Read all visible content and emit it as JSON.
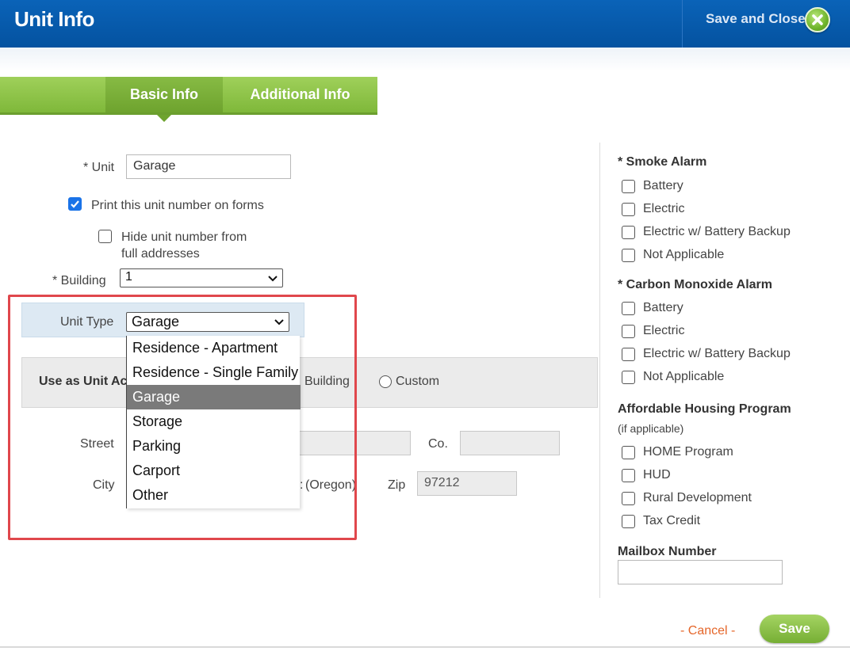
{
  "header": {
    "title": "Unit Info",
    "save_close_label": "Save and Close",
    "close_icon": "close-circle-icon"
  },
  "tabs": [
    {
      "label": "Basic Info",
      "active": true
    },
    {
      "label": "Additional Info",
      "active": false
    }
  ],
  "form": {
    "unit_label": "* Unit",
    "unit_value": "Garage",
    "print_unit_label": "Print this unit number on forms",
    "print_unit_checked": true,
    "hide_unit_label_line1": "Hide unit number from",
    "hide_unit_label_line2": "full addresses",
    "hide_unit_checked": false,
    "building_label": "* Building",
    "building_value": "1",
    "unit_type_label": "Unit Type",
    "unit_type_value": "Garage",
    "unit_type_options": [
      "Residence - Apartment",
      "Residence - Single Family",
      "Garage",
      "Storage",
      "Parking",
      "Carport",
      "Other"
    ],
    "unit_type_selected_index": 2,
    "use_as_label": "Use as Unit Ac",
    "radio_building_label": "Building",
    "radio_custom_label": "Custom",
    "street_label": "Street",
    "co_label": "Co.",
    "city_label": "City",
    "state_text": "(Oregon)",
    "zip_label": "Zip",
    "zip_value": "97212"
  },
  "right_panel": {
    "smoke_alarm_title": "* Smoke Alarm",
    "smoke_alarm_options": [
      "Battery",
      "Electric",
      "Electric w/ Battery Backup",
      "Not Applicable"
    ],
    "co_alarm_title": "* Carbon Monoxide Alarm",
    "co_alarm_options": [
      "Battery",
      "Electric",
      "Electric w/ Battery Backup",
      "Not Applicable"
    ],
    "housing_title": "Affordable Housing Program",
    "housing_subtitle": "(if applicable)",
    "housing_options": [
      "HOME Program",
      "HUD",
      "Rural Development",
      "Tax Credit"
    ],
    "mailbox_title": "Mailbox Number",
    "mailbox_value": ""
  },
  "footer": {
    "cancel_label": "- Cancel -",
    "save_label": "Save"
  },
  "colors": {
    "header_blue": "#0452a0",
    "tab_green": "#7fb83a",
    "highlight_red": "#e0474c",
    "cancel_orange": "#e5662a"
  }
}
